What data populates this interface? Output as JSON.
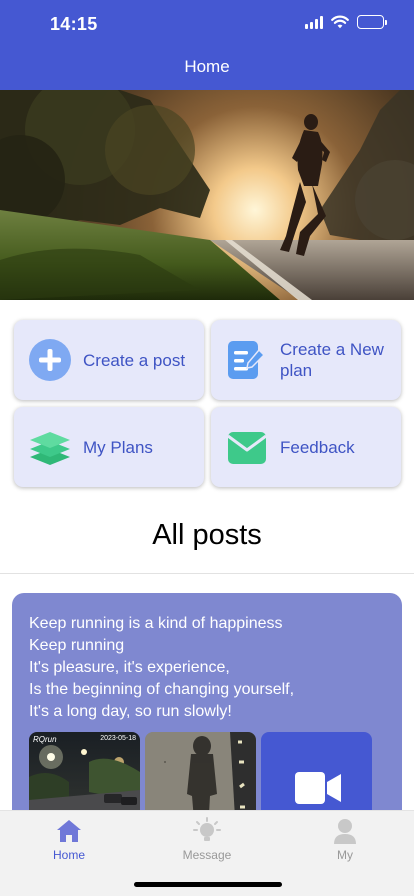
{
  "status_bar": {
    "time": "14:15"
  },
  "header": {
    "title": "Home"
  },
  "actions": [
    {
      "label": "Create a post",
      "icon": "plus-circle-icon",
      "color": "#7fa9f2"
    },
    {
      "label": "Create a New plan",
      "icon": "edit-document-icon",
      "color": "#5b9cf0"
    },
    {
      "label": "My Plans",
      "icon": "layers-icon",
      "color": "#3ec98a"
    },
    {
      "label": "Feedback",
      "icon": "envelope-icon",
      "color": "#3ec98a"
    }
  ],
  "section_title": "All posts",
  "post": {
    "lines": [
      "Keep running is a kind of happiness",
      "Keep running",
      "It's pleasure, it's experience,",
      "Is the beginning of changing yourself,",
      "It's a long day, so run slowly!"
    ],
    "thumb1_caption_left": "RQrun",
    "thumb1_caption_right": "2023-05-18"
  },
  "tabbar": {
    "home": "Home",
    "message": "Message",
    "my": "My"
  },
  "colors": {
    "primary": "#4558d2",
    "card_bg": "#e6e8fa",
    "post_bg": "#7f88d0"
  }
}
